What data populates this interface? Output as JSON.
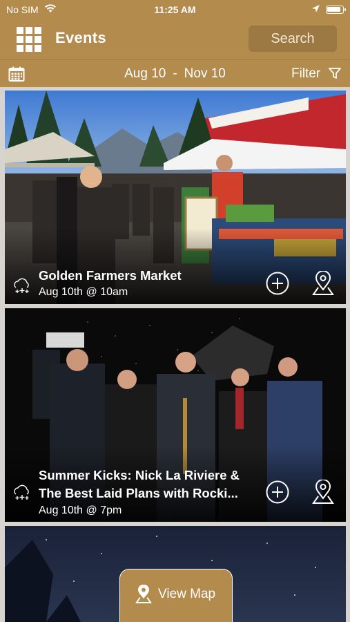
{
  "status_bar": {
    "carrier": "No SIM",
    "time": "11:25 AM"
  },
  "header": {
    "title": "Events",
    "search_label": "Search",
    "menu_icon": "grid-menu-icon"
  },
  "date_bar": {
    "start": "Aug 10",
    "separator": "-",
    "end": "Nov 10",
    "filter_label": "Filter",
    "calendar_icon": "calendar-icon",
    "filter_icon": "funnel-icon"
  },
  "events": [
    {
      "title": "Golden Farmers Market",
      "date": "Aug 10th @ 10am",
      "category_icon": "weather-icon"
    },
    {
      "title": "Summer Kicks: Nick La Riviere & The Best Laid Plans with Rocki...",
      "date": "Aug 10th @ 7pm",
      "category_icon": "weather-icon"
    }
  ],
  "view_map": {
    "label": "View Map"
  },
  "colors": {
    "brand": "#b38b4d",
    "brand_dark": "#9c7843",
    "card_background": "#d7d3cf"
  }
}
